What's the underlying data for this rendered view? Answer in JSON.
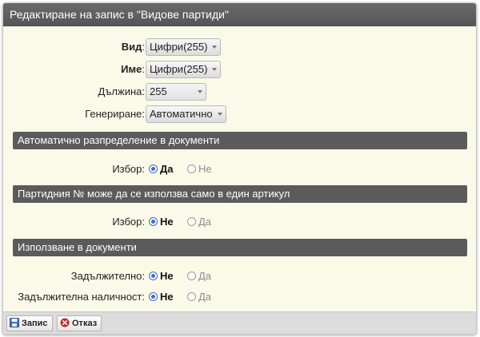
{
  "dialog": {
    "title": "Редактиране на запис в \"Видове партиди\""
  },
  "fields": {
    "vid": {
      "label": "Вид",
      "value": "Цифри(255)"
    },
    "ime": {
      "label": "Име",
      "value": "Цифри(255)"
    },
    "duljina": {
      "label": "Дължина:",
      "value": "255"
    },
    "generirane": {
      "label": "Генериране:",
      "value": "Автоматично"
    }
  },
  "sections": [
    {
      "title": "Автоматично разпределение в документи",
      "rows": [
        {
          "label": "Избор:",
          "options": [
            "Да",
            "Не"
          ],
          "selected": "Да"
        }
      ]
    },
    {
      "title": "Партидния № може да се използва само в един артикул",
      "rows": [
        {
          "label": "Избор:",
          "options": [
            "Не",
            "Да"
          ],
          "selected": "Не"
        }
      ]
    },
    {
      "title": "Използване в документи",
      "rows": [
        {
          "label": "Задължително:",
          "options": [
            "Не",
            "Да"
          ],
          "selected": "Не"
        },
        {
          "label": "Задължителна наличност:",
          "options": [
            "Не",
            "Да"
          ],
          "selected": "Не"
        }
      ]
    }
  ],
  "toolbar": {
    "save_label": "Запис",
    "cancel_label": "Отказ"
  },
  "colors": {
    "titlebar": "#5b5b5b",
    "form_bg": "#fbfae9",
    "radio_accent": "#3b6fc4",
    "cancel_icon": "#c62828"
  }
}
